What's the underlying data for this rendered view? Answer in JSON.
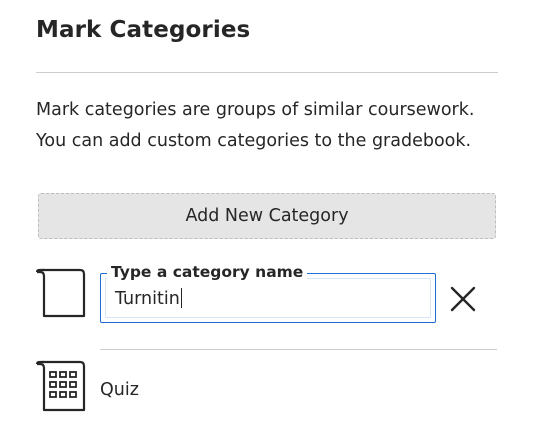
{
  "panel": {
    "title": "Mark Categories",
    "description_lines": [
      "Mark categories are groups of similar coursework.",
      "You can add custom categories to the gradebook."
    ],
    "add_button_label": "Add New Category"
  },
  "new_category": {
    "field_label": "Type a category name",
    "value": "Turnitin",
    "icon": "blank-document-icon",
    "clear_icon": "close-icon"
  },
  "categories": [
    {
      "label": "Quiz",
      "icon": "quiz-grid-icon"
    }
  ],
  "colors": {
    "focus_border": "#1f6fd1",
    "button_bg": "#e5e5e5",
    "text": "#262626"
  }
}
